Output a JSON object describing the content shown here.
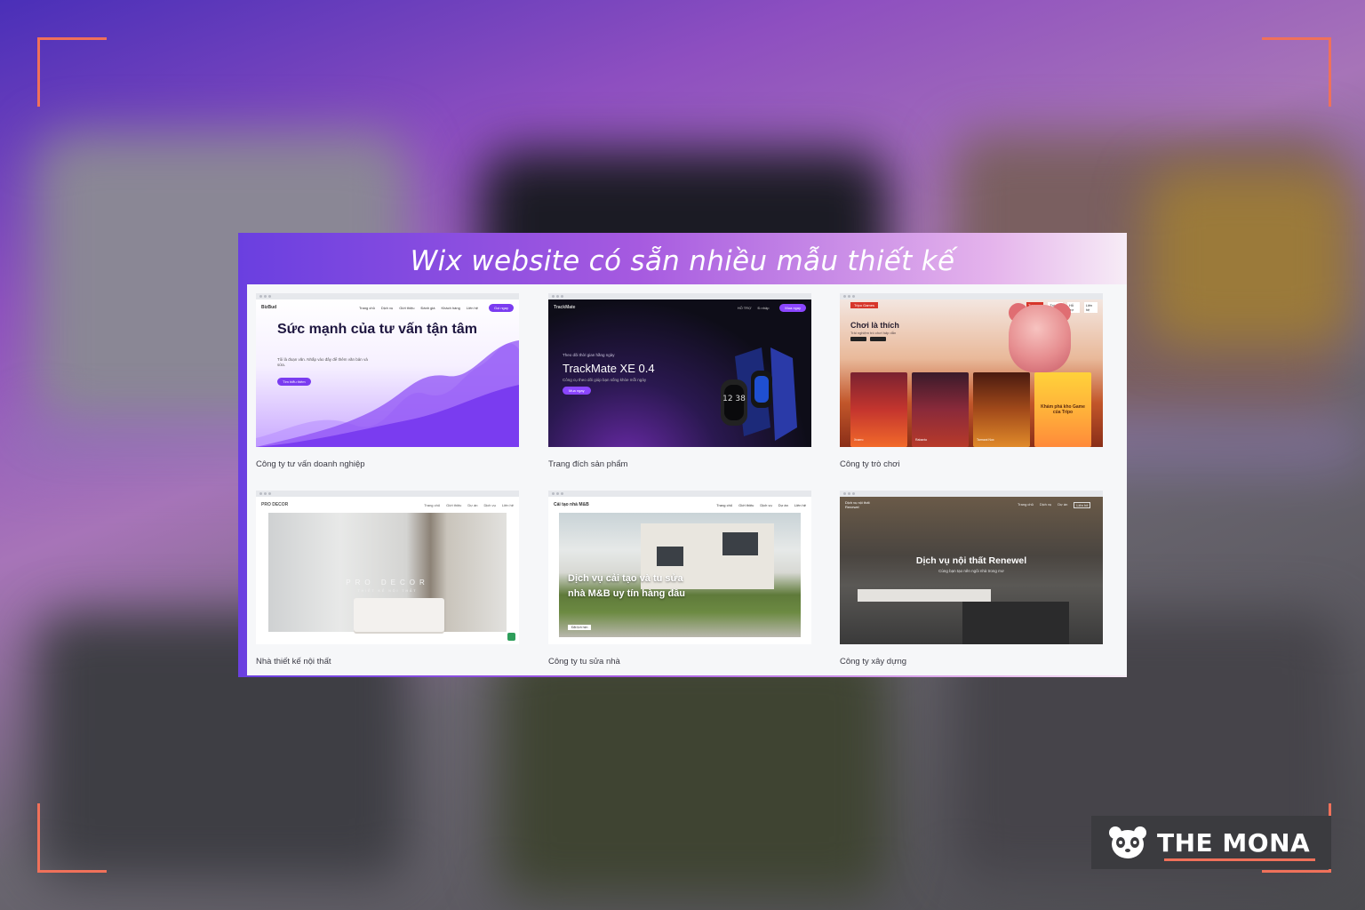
{
  "page": {
    "heading": "Wix website có sẵn nhiều mẫu thiết kế",
    "brand": "THE MONA",
    "accent_color": "#f0715a"
  },
  "templates": [
    {
      "caption": "Công ty tư vấn doanh nghiệp",
      "logo": "BizBud",
      "nav": [
        "Trang chủ",
        "Dịch vụ",
        "Giới thiệu",
        "Đánh giá",
        "Khách hàng",
        "Liên hệ"
      ],
      "cta": "Gọi ngay",
      "headline": "Sức mạnh của tư vấn tận tâm",
      "body": "Tôi là đoạn văn. Nhấp vào đây để thêm văn bản và sửa.",
      "button": "Tìm hiểu thêm"
    },
    {
      "caption": "Trang đích sản phẩm",
      "logo": "TrackMate",
      "nav": [
        "HỖ TRỢ",
        "Đ.nhập"
      ],
      "cta": "Mua ngay",
      "eyebrow": "Theo dõi thời gian hằng ngày",
      "headline": "TrackMate XE 0.4",
      "body": "Công cụ theo dõi giúp bạn sống khỏe mỗi ngày",
      "button": "Mua ngay",
      "watch_time": "12 38"
    },
    {
      "caption": "Công ty trò chơi",
      "logo": "Tripo Games",
      "nav": [
        "Trang chủ",
        "Trò chơi",
        "Hỗ trợ",
        "Liên hệ"
      ],
      "headline": "Chơi là thích",
      "body": "Trải nghiệm trò chơi hấp dẫn",
      "cards": [
        "Xnarro",
        "Rabanto",
        "Tarmani Nox"
      ],
      "last_card": "Khám phá kho Game của Tripo"
    },
    {
      "caption": "Nhà thiết kế nội thất",
      "logo": "PRO DECOR",
      "nav": [
        "Trang chủ",
        "Giới thiệu",
        "Dự án",
        "Dịch vụ",
        "Liên hệ"
      ],
      "headline": "PRO DECOR",
      "subtitle": "THIẾT KẾ NỘI THẤT"
    },
    {
      "caption": "Công ty tu sửa nhà",
      "logo": "Cải tạo nhà M&B",
      "nav": [
        "Trang chủ",
        "Giới thiệu",
        "Dịch vụ",
        "Dự án",
        "Liên hệ"
      ],
      "headline": "Dịch vụ cải tạo và tu sửa nhà M&B uy tín hàng đầu",
      "button": "Đặt lịch hẹn"
    },
    {
      "caption": "Công ty xây dựng",
      "logo": "Dịch vụ nội thất Renewel",
      "nav": [
        "Trang chủ",
        "Dịch vụ",
        "Dự án",
        "Liên hệ"
      ],
      "headline": "Dịch vụ nội thất Renewel",
      "body": "Cùng bạn tạo nên ngôi nhà trong mơ"
    }
  ]
}
